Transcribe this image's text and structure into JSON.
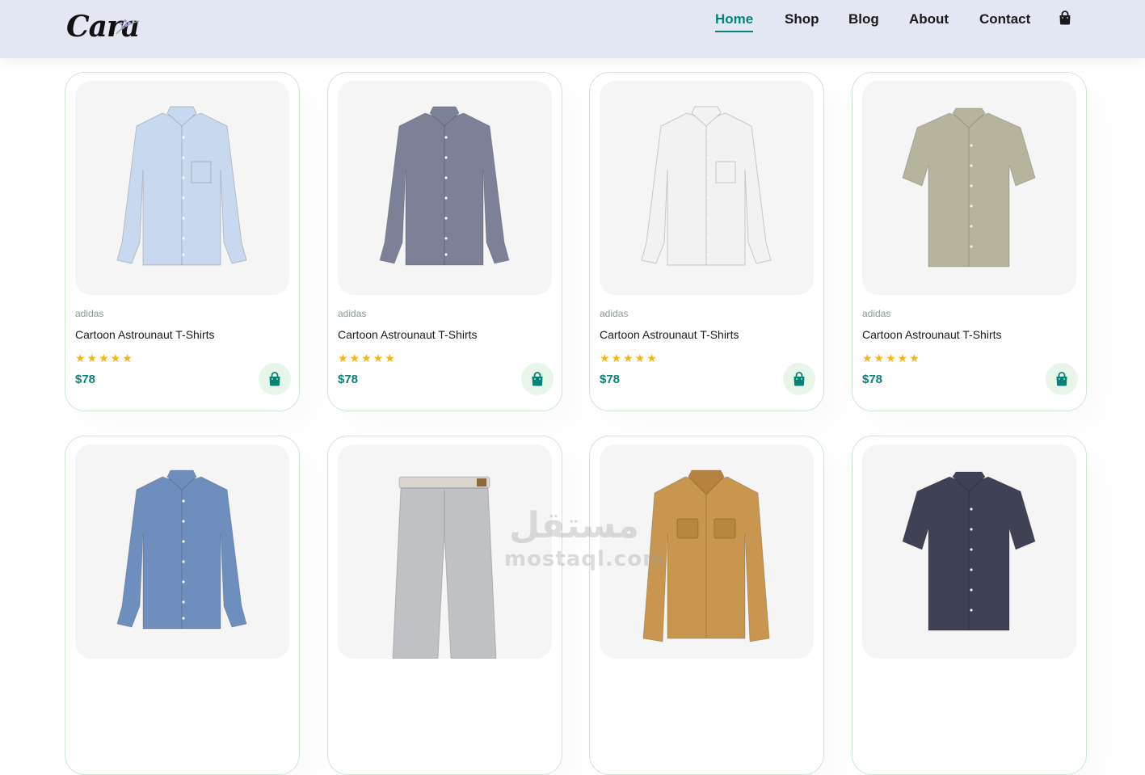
{
  "header": {
    "logo": "Cara",
    "nav": [
      {
        "label": "Home",
        "active": true
      },
      {
        "label": "Shop",
        "active": false
      },
      {
        "label": "Blog",
        "active": false
      },
      {
        "label": "About",
        "active": false
      },
      {
        "label": "Contact",
        "active": false
      }
    ],
    "bag_icon": "shopping-bag-icon"
  },
  "colors": {
    "accent": "#088178",
    "header_bg": "#e3e6f3",
    "star": "#f3b519",
    "cart_bg": "#e8f6ea",
    "card_border": "#cce7d0"
  },
  "products": [
    {
      "brand": "adidas",
      "title": "Cartoon Astrounaut T-Shirts",
      "rating": 5,
      "stars": "★★★★★",
      "price": "$78",
      "shirt": "#c8d8ee",
      "style": "long-pocket"
    },
    {
      "brand": "adidas",
      "title": "Cartoon Astrounaut T-Shirts",
      "rating": 5,
      "stars": "★★★★★",
      "price": "$78",
      "shirt": "#7c8198",
      "style": "long-collar"
    },
    {
      "brand": "adidas",
      "title": "Cartoon Astrounaut T-Shirts",
      "rating": 5,
      "stars": "★★★★★",
      "price": "$78",
      "shirt": "#f2f2f2",
      "style": "long-pocket"
    },
    {
      "brand": "adidas",
      "title": "Cartoon Astrounaut T-Shirts",
      "rating": 5,
      "stars": "★★★★★",
      "price": "$78",
      "shirt": "#b7b49e",
      "style": "short"
    },
    {
      "shirt": "#6e8fbd",
      "style": "long-collar"
    },
    {
      "shirt": "#bfc1c5",
      "style": "pants"
    },
    {
      "shirt": "#c99650",
      "style": "jacket"
    },
    {
      "shirt": "#3f4154",
      "style": "short"
    }
  ],
  "watermark": {
    "logo": "مستقل",
    "text": "mostaql.com"
  }
}
